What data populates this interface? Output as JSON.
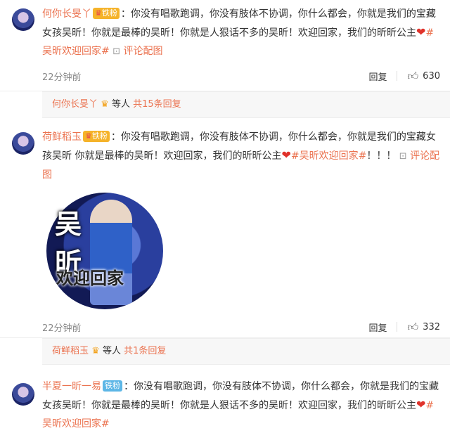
{
  "comments": [
    {
      "user": "何你长旻丫",
      "badge": "铁粉",
      "text_part1": "：你没有唱歌跑调，你没有肢体不协调，你什么都会，你就是我们的宝藏女孩吴昕！你就是最棒的吴昕！你就是人狠话不多的吴昕！欢迎回家，我们的昕昕公主",
      "tag": "#吴昕欢迎回家#",
      "img_link": "评论配图",
      "time": "22分钟前",
      "reply_label": "回复",
      "likes": "630",
      "replies": {
        "user": "何你长旻丫",
        "text": "等人",
        "link": "共15条回复"
      }
    },
    {
      "user": "荷鲜稻玉",
      "badge": "铁粉",
      "text_part1": "：你没有唱歌跑调，你没有肢体不协调，你什么都会，你就是我们的宝藏女孩吴昕 你就是最棒的吴昕！欢迎回家，我们的昕昕公主",
      "tag": "#吴昕欢迎回家#",
      "tail": "！！！",
      "img_link": "评论配图",
      "picture": {
        "text_top": "吴昕",
        "text_bottom": "欢迎回家"
      },
      "time": "22分钟前",
      "reply_label": "回复",
      "likes": "332",
      "replies": {
        "user": "荷鲜稻玉",
        "text": "等人",
        "link": "共1条回复"
      }
    },
    {
      "user": "半夏一昕一易",
      "badge": "铁粉",
      "text_part1": "：你没有唱歌跑调，你没有肢体不协调，你什么都会，你就是我们的宝藏女孩吴昕！你就是最棒的吴昕！你就是人狠话不多的吴昕！欢迎回家，我们的昕昕公主",
      "tag": "#吴昕欢迎回家#"
    }
  ],
  "colors": {
    "accent": "#eb7350",
    "heart": "#e0322b",
    "badge_gold": "#f5b32a",
    "badge_blue": "#5cb6e6"
  }
}
